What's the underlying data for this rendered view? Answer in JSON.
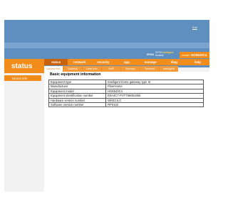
{
  "header": {
    "top_link": "Exit",
    "brand_logo": "EPON",
    "brand_line1": "GPON",
    "brand_line2": "intelligent",
    "brand_line3": "terminal",
    "model_label": "model",
    "model_value": "HG6543C4"
  },
  "side": {
    "title": "status",
    "items": [
      {
        "label": "Device Info"
      }
    ]
  },
  "main_nav": [
    {
      "label": "status",
      "active": true
    },
    {
      "label": "network",
      "active": false
    },
    {
      "label": "security",
      "active": false
    },
    {
      "label": "app",
      "active": false
    },
    {
      "label": "manage",
      "active": false
    },
    {
      "label": "diag",
      "active": false
    },
    {
      "label": "help",
      "active": false
    }
  ],
  "sub_nav": [
    {
      "label": "Device Info",
      "active": true
    },
    {
      "label": "Network",
      "active": false
    },
    {
      "label": "User Info",
      "active": false
    },
    {
      "label": "VoIP",
      "active": false
    },
    {
      "label": "Remote",
      "active": false
    },
    {
      "label": "Terminal",
      "active": false
    },
    {
      "label": "Intelligent",
      "active": false
    }
  ],
  "content": {
    "title": "Basic equipment information",
    "rows": [
      {
        "key": "Equipment type",
        "value": "Intelligent home gateway type III"
      },
      {
        "key": "Manufacturer",
        "value": "FiberHome"
      },
      {
        "key": "Equipment model",
        "value": "HG6543C4"
      },
      {
        "key": "Equipment identification number",
        "value": "E0A4C7-FHTT55651556"
      },
      {
        "key": "Hardware version number",
        "value": "WKE2.5.0"
      },
      {
        "key": "Software version number",
        "value": "RP0102"
      }
    ]
  }
}
